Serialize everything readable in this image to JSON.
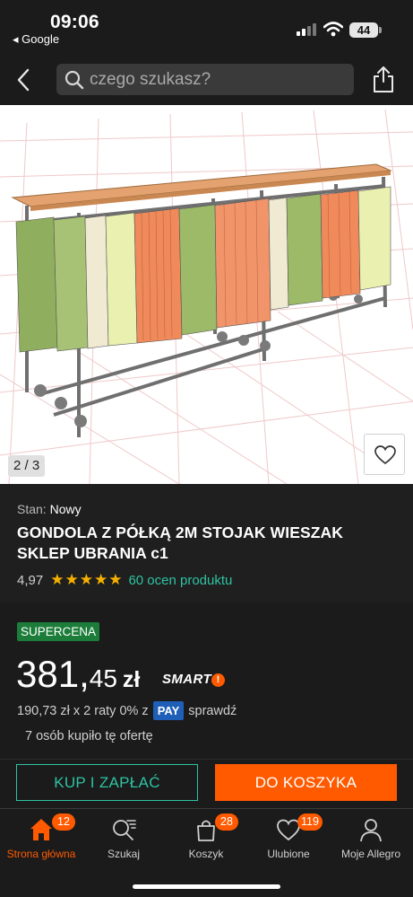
{
  "status_bar": {
    "time": "09:06",
    "back_app": "◂ Google",
    "battery": "44"
  },
  "search": {
    "placeholder": "czego szukasz?"
  },
  "gallery": {
    "counter": "2 / 3"
  },
  "product": {
    "condition_label": "Stan:",
    "condition_value": "Nowy",
    "title": "GONDOLA Z PÓŁKĄ 2M STOJAK WIESZAK SKLEP UBRANIA c1",
    "rating": "4,97",
    "stars": 5,
    "rating_link": "60 ocen produktu"
  },
  "pricing": {
    "badge": "SUPERCENA",
    "price_main": "381,",
    "price_fraction": "45",
    "currency": "zł",
    "smart_label": "SMART",
    "smart_mark": "!",
    "installments_text": "190,73 zł x 2 raty 0% z",
    "pay_label": "PAY",
    "check_label": "sprawdź",
    "bought_text": "7 osób kupiło tę ofertę"
  },
  "actions": {
    "buy_now": "KUP I ZAPŁAĆ",
    "add_to_cart": "DO KOSZYKA"
  },
  "tabbar": {
    "items": [
      {
        "label": "Strona główna",
        "icon": "home-icon",
        "badge": "12"
      },
      {
        "label": "Szukaj",
        "icon": "search-icon",
        "badge": ""
      },
      {
        "label": "Koszyk",
        "icon": "cart-icon",
        "badge": "28"
      },
      {
        "label": "Ulubione",
        "icon": "heart-icon",
        "badge": "119"
      },
      {
        "label": "Moje Allegro",
        "icon": "user-icon",
        "badge": ""
      }
    ]
  },
  "colors": {
    "accent": "#ff5a00",
    "link": "#2ec3a3",
    "badge_green": "#1c7d3a",
    "background": "#1b1b1b"
  }
}
